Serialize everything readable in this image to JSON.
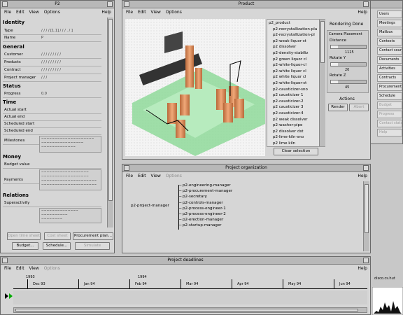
{
  "p2": {
    "title": "P2",
    "menu": {
      "file": "File",
      "edit": "Edit",
      "view": "View",
      "options": "Options",
      "help": "Help"
    },
    "sections": {
      "identity": "Identity",
      "general": "General",
      "status": "Status",
      "time": "Time",
      "money": "Money",
      "relations": "Relations"
    },
    "identity": [
      {
        "label": "Type",
        "value": "/ / / / [1.1] / / / . / ]"
      },
      {
        "label": "Name",
        "value": "P"
      }
    ],
    "general": [
      {
        "label": "Customer",
        "value": "/ / / / / / / / /"
      },
      {
        "label": "Products",
        "value": "/ / / / / / / / /"
      },
      {
        "label": "Contract",
        "value": "/ / / / / / / / /"
      },
      {
        "label": "Project manager",
        "value": "/ / /"
      }
    ],
    "status": [
      {
        "label": "Progress",
        "value": "0.0"
      }
    ],
    "time": [
      {
        "label": "Actual start",
        "value": ""
      },
      {
        "label": "Actual end",
        "value": ""
      },
      {
        "label": "Scheduled start",
        "value": ""
      },
      {
        "label": "Scheduled end",
        "value": ""
      },
      {
        "label": "Milestones",
        "value": ""
      }
    ],
    "money": [
      {
        "label": "Budget value",
        "value": ""
      },
      {
        "label": "Payments",
        "value": ""
      }
    ],
    "relations": [
      {
        "label": "Superactivity",
        "value": ""
      }
    ],
    "buttons": {
      "open_time_sheet": "Open time sheet",
      "open_sheet": "Cost sheet",
      "procurement_plan": "Procurement plan...",
      "budget": "Budget...",
      "schedule": "Schedule...",
      "simulate": "Simulate"
    }
  },
  "product": {
    "title": "Product",
    "menu": {
      "file": "File",
      "edit": "Edit",
      "view": "View",
      "options": "Options",
      "help": "Help"
    },
    "list": [
      "p2_product",
      "p2-recrystallization-pla",
      "p2-recrystallization-pl",
      "p2-weak-liquor-st",
      "p2 dissolver",
      "p2-density-stabiliz",
      "p2 green liquor cl",
      "p2-white-liquor-cl",
      "p2-white liquor cl",
      "p2 white liquor cl",
      "p2-white-liquor-st",
      "p2-causticizer-sno",
      "p2 causticizer 1",
      "p2-causticizer-2",
      "p2 causticizer 3",
      "p2-causticizer-4",
      "p2 weak dissolver",
      "p2-washer-pipe",
      "p2 dissolver dst",
      "p2-lime-kiln-sno",
      "p2 lime kiln"
    ],
    "clear_selection": "Clear selection",
    "rendering": "Rendering Done",
    "camera_title": "Camera Placement",
    "distance_label": "Distance",
    "distance_value": "1125",
    "rotate_y_label": "Rotate Y",
    "rotate_y_value": "20",
    "rotate_z_label": "Rotate Z",
    "rotate_z_value": "45",
    "actions_label": "Actions",
    "render": "Render",
    "abort": "Abort"
  },
  "org": {
    "title": "Project organization",
    "menu": {
      "file": "File",
      "edit": "Edit",
      "view": "View",
      "options": "Options",
      "help": "Help"
    },
    "root": "p2-project-manager",
    "children": [
      "p2-engineering-manager",
      "p2-procurement-manager",
      "p2-secretary",
      "p2-controls-manager",
      "p2-process-engineer-1",
      "p2-process-engineer-2",
      "p2-erection-manager",
      "p2-startup-manager"
    ]
  },
  "deadlines": {
    "title": "Project deadlines",
    "menu": {
      "file": "File",
      "edit": "Edit",
      "view": "View",
      "options": "Options",
      "help": "Help"
    },
    "years": [
      "1993",
      "1994"
    ],
    "months": [
      "Dec 93",
      "Jan 94",
      "Feb 94",
      "Mar 94",
      "Apr 94",
      "May 94",
      "Jun 94"
    ]
  },
  "side_menu": [
    "Users",
    "Meetings",
    "Mailbox",
    "Contexts",
    "Contact sources",
    "Documents",
    "Activities",
    "Contracts",
    "Procurement",
    "Schedule",
    "Budget",
    "Progress",
    "Contact status",
    "Help"
  ],
  "hostname": "disco.cs.hut",
  "colors": {
    "window_bg": "#d6d6d6",
    "desktop": "#c8c8c8",
    "viewport_bg": "#ffffff",
    "green_base": "#8fd99a",
    "tank": "#e09060"
  }
}
